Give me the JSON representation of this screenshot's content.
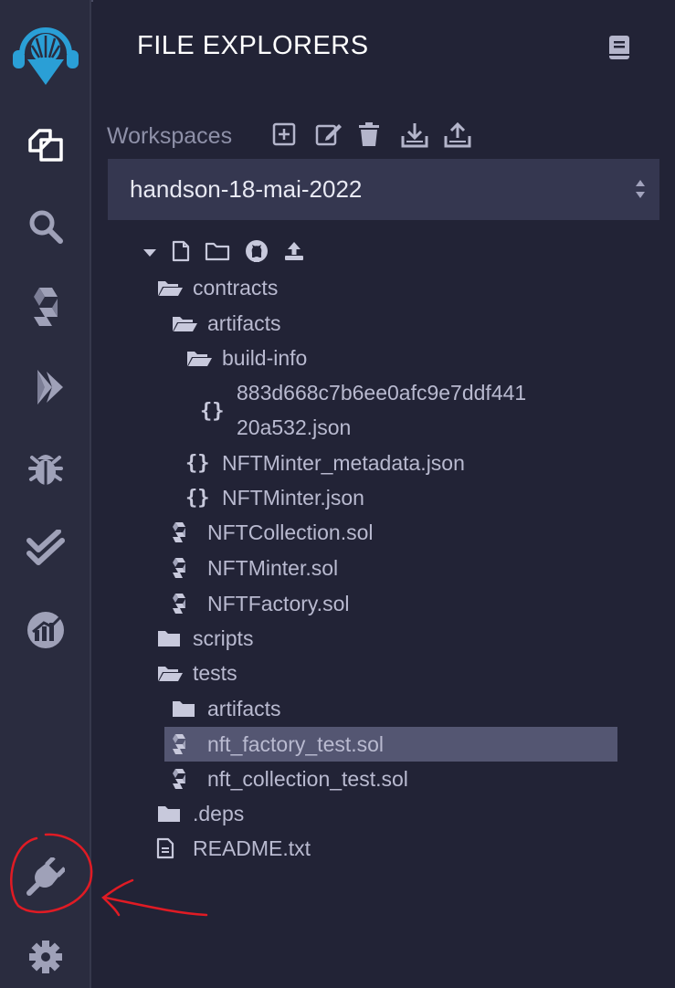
{
  "colors": {
    "rail_bg": "#2a2c3f",
    "panel_bg": "#222336",
    "select_bg": "#353750",
    "selected_row": "#545672",
    "accent_logo": "#2a9fd6",
    "annotation_red": "#e01b24"
  },
  "rail": {
    "items": [
      {
        "icon": "remix-logo-icon"
      },
      {
        "icon": "file-explorer-icon"
      },
      {
        "icon": "search-icon"
      },
      {
        "icon": "solidity-compiler-icon"
      },
      {
        "icon": "deploy-run-icon"
      },
      {
        "icon": "debugger-icon"
      },
      {
        "icon": "solidity-unit-testing-icon"
      },
      {
        "icon": "analysis-icon"
      },
      {
        "icon": "plugin-manager-icon"
      },
      {
        "icon": "settings-icon"
      }
    ]
  },
  "panel": {
    "title": "FILE EXPLORERS",
    "doc_icon": "documentation-icon"
  },
  "workspaces": {
    "label": "Workspaces",
    "actions": [
      "create-workspace-icon",
      "rename-workspace-icon",
      "delete-workspace-icon",
      "download-workspace-icon",
      "restore-workspace-icon"
    ],
    "selected": "handson-18-mai-2022"
  },
  "tree_toolbar": [
    "caret-down-icon",
    "new-file-icon",
    "new-folder-icon",
    "github-icon",
    "upload-icon"
  ],
  "tree": [
    {
      "label": "contracts",
      "type": "folder-open",
      "depth": 0
    },
    {
      "label": "artifacts",
      "type": "folder-open",
      "depth": 1
    },
    {
      "label": "build-info",
      "type": "folder-open",
      "depth": 2
    },
    {
      "label": "883d668c7b6ee0afc9e7ddf441",
      "label2": "20a532.json",
      "type": "json",
      "depth": 3
    },
    {
      "label": "NFTMinter_metadata.json",
      "type": "json",
      "depth": 2
    },
    {
      "label": "NFTMinter.json",
      "type": "json",
      "depth": 2
    },
    {
      "label": "NFTCollection.sol",
      "type": "sol",
      "depth": 1
    },
    {
      "label": "NFTMinter.sol",
      "type": "sol",
      "depth": 1
    },
    {
      "label": "NFTFactory.sol",
      "type": "sol",
      "depth": 1
    },
    {
      "label": "scripts",
      "type": "folder",
      "depth": 0
    },
    {
      "label": "tests",
      "type": "folder-open",
      "depth": 0
    },
    {
      "label": "artifacts",
      "type": "folder",
      "depth": 1
    },
    {
      "label": "nft_factory_test.sol",
      "type": "sol",
      "depth": 1,
      "selected": true
    },
    {
      "label": "nft_collection_test.sol",
      "type": "sol",
      "depth": 1
    },
    {
      "label": ".deps",
      "type": "folder",
      "depth": 0
    },
    {
      "label": "README.txt",
      "type": "txt",
      "depth": 0
    }
  ]
}
